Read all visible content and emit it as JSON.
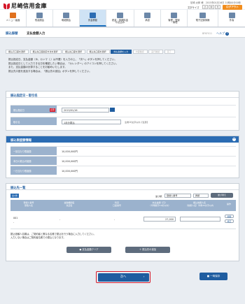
{
  "header": {
    "bank_name": "尼崎信用金庫",
    "user_line": "尼崎 太郎 様　2015年01月16日 10時00分00秒",
    "text_size_label": "文字サイズ",
    "text_size_buttons": [
      "小",
      "中",
      "大"
    ],
    "logout_label": "ログアウト"
  },
  "nav": [
    {
      "icon": "home-icon",
      "label": "メニュー画面"
    },
    {
      "icon": "balance-icon",
      "label": "残高照会"
    },
    {
      "icon": "statement-icon",
      "label": "明細照会"
    },
    {
      "icon": "transfer-icon",
      "label": "資金移動"
    },
    {
      "icon": "tax-icon",
      "label": "税金・各種料金\nの払込み"
    },
    {
      "icon": "approval-icon",
      "label": "承認"
    },
    {
      "icon": "admin-icon",
      "label": "管理・登録\n・管理"
    },
    {
      "icon": "ecrecord-icon",
      "label": "電子記録債権"
    },
    {
      "icon": "external-icon",
      "label": "外為"
    }
  ],
  "page": {
    "breadcrumb_main": "振込振替",
    "title": "支払金額入力",
    "screen_code": "BFKF011",
    "help_label": "ヘルプ"
  },
  "steps": [
    "振込元口座を選択",
    "振込先口座指定方法を選択",
    "振込先口座を選択",
    "振込先口座を選択",
    "支払金額を入力",
    "内容確認",
    "実行確認",
    "完了"
  ],
  "instructions": [
    "振込指定日、支払金額（ゆ、カンマ（,）は不要）を入力の上、「次へ」ボタンを押してください。",
    "振込指定日として入力できる日を確認したい場合は、「カレンダー」のアイコンを押してください。",
    "また、支払金額の計算することをお勧めいたします。",
    "振込先口座を追加する場合は、「振込先の追加」ボタンを押してください。"
  ],
  "transfer_date_section": {
    "title": "振込指定日・取引名",
    "date_label": "振込指定日",
    "required_label": "必須",
    "date_value": "2015/01/16",
    "name_label": "取引名",
    "name_value": "1月分振込",
    "name_note": "全角10文字以内【任意】"
  },
  "source_section": {
    "title": "振込限度額情報",
    "rows": [
      {
        "label": "一回当たり限度額",
        "value": "10,000,000円"
      },
      {
        "label": "本日の振込可能額",
        "value": "10,000,000円"
      },
      {
        "label": "一日当たり限度額",
        "value": "10,000,000円"
      }
    ]
  },
  "payee_section": {
    "title": "振込先一覧",
    "count_label": "全1件",
    "sort_label": "並び順：",
    "sort_value": "登録人番号",
    "order_value": "昇順",
    "sort_button": "並び替え",
    "columns": [
      "登録人番号\n受取人名",
      "金融機関名\n支店名",
      "科目\n口座番号",
      "支払金額（円）\n（半角数字11桁以内）",
      "振込依頼人名\n（依頼人名）半角30文字以内",
      "操作"
    ],
    "rows": [
      {
        "no": "001",
        "name": "-",
        "bank": "-",
        "branch": "-",
        "account": "-",
        "amount": "27,000",
        "requester": "",
        "ops": [
          "削除",
          "修正"
        ]
      }
    ],
    "note_lines": [
      "振込依頼人名欄は、ご契約者と異なる名義で振込を行う場合に入力してください。",
      "入力しない場合はご契約者名義での振込となります。"
    ],
    "clear_button": "支払金額クリア",
    "add_button": "振込先の追加"
  },
  "actions": {
    "next_label": "次へ",
    "save_label": "一時保存"
  }
}
